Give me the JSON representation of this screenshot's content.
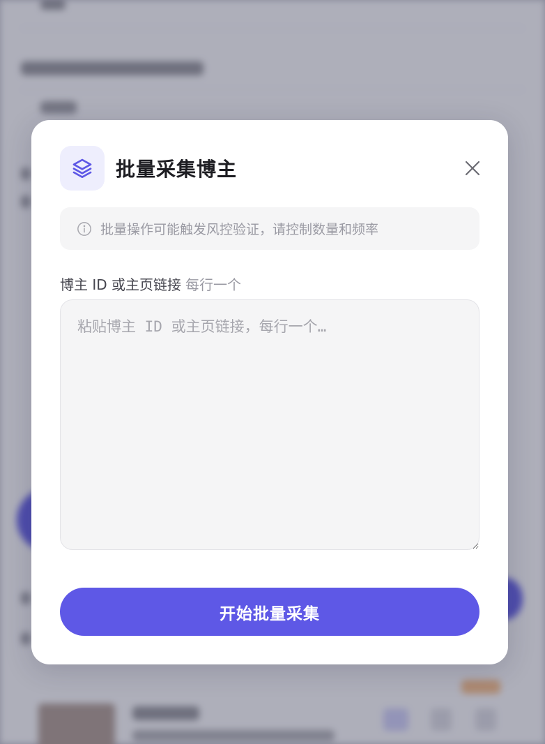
{
  "modal": {
    "title": "批量采集博主",
    "header_icon": "layers-icon",
    "close_icon": "close-icon",
    "notice": {
      "icon": "info-icon",
      "text": "批量操作可能触发风控验证，请控制数量和频率"
    },
    "field": {
      "label": "博主 ID 或主页链接",
      "hint": "每行一个",
      "placeholder": "粘贴博主 ID 或主页链接，每行一个…",
      "value": ""
    },
    "submit_label": "开始批量采集"
  },
  "colors": {
    "accent": "#5e58e6",
    "icon_bg": "#eeeefd",
    "notice_bg": "#f5f5f6",
    "muted_text": "#9a9aa3"
  }
}
